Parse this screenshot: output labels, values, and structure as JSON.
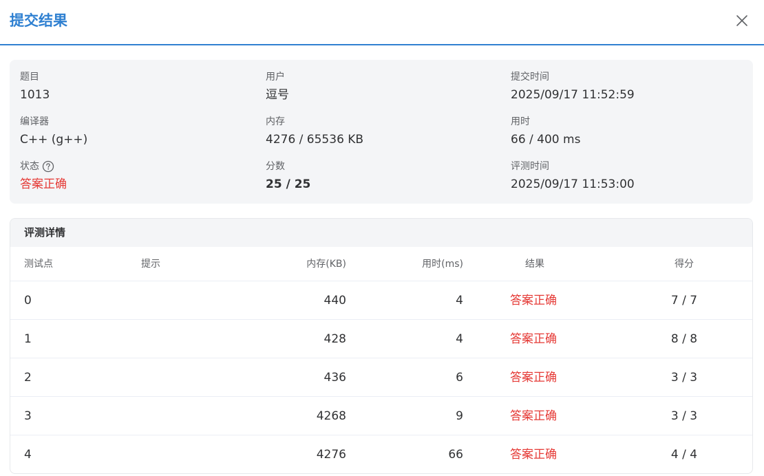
{
  "dialog": {
    "title": "提交结果"
  },
  "info": {
    "problem": {
      "label": "题目",
      "value": "1013"
    },
    "user": {
      "label": "用户",
      "value": "逗号"
    },
    "submit_time": {
      "label": "提交时间",
      "value": "2025/09/17 11:52:59"
    },
    "compiler": {
      "label": "编译器",
      "value": "C++ (g++)"
    },
    "memory": {
      "label": "内存",
      "value": "4276 / 65536 KB"
    },
    "time": {
      "label": "用时",
      "value": "66 / 400 ms"
    },
    "status": {
      "label": "状态",
      "value": "答案正确",
      "color": "#e53935",
      "help_icon": "question-circle-icon"
    },
    "score": {
      "label": "分数",
      "value": "25 / 25"
    },
    "judge_time": {
      "label": "评测时间",
      "value": "2025/09/17 11:53:00"
    }
  },
  "details": {
    "title": "评测详情",
    "columns": {
      "case": "测试点",
      "hint": "提示",
      "memory": "内存(KB)",
      "time": "用时(ms)",
      "result": "结果",
      "score": "得分"
    },
    "rows": [
      {
        "case": "0",
        "hint": "",
        "memory": "440",
        "time": "4",
        "result": "答案正确",
        "score": "7 / 7"
      },
      {
        "case": "1",
        "hint": "",
        "memory": "428",
        "time": "4",
        "result": "答案正确",
        "score": "8 / 8"
      },
      {
        "case": "2",
        "hint": "",
        "memory": "436",
        "time": "6",
        "result": "答案正确",
        "score": "3 / 3"
      },
      {
        "case": "3",
        "hint": "",
        "memory": "4268",
        "time": "9",
        "result": "答案正确",
        "score": "3 / 3"
      },
      {
        "case": "4",
        "hint": "",
        "memory": "4276",
        "time": "66",
        "result": "答案正确",
        "score": "4 / 4"
      }
    ]
  },
  "colors": {
    "accent": "#2f80d1",
    "accepted": "#e53935",
    "card_bg": "#f4f5f7"
  }
}
